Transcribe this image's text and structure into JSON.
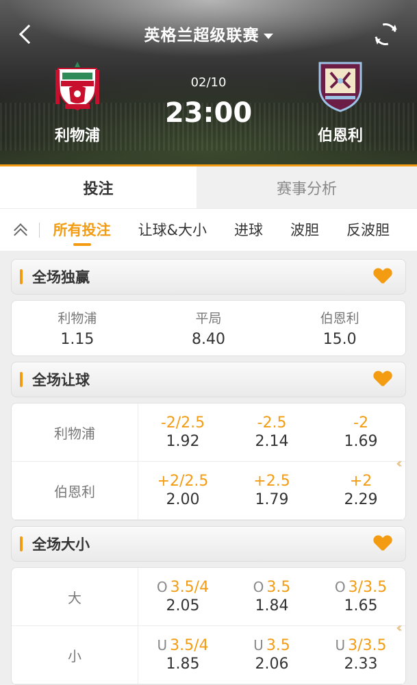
{
  "header": {
    "league": "英格兰超级联赛",
    "date": "02/10",
    "time": "23:00",
    "home_team": "利物浦",
    "away_team": "伯恩利"
  },
  "tabs": {
    "bet": "投注",
    "analysis": "赛事分析"
  },
  "sub_tabs": [
    "所有投注",
    "让球&大小",
    "进球",
    "波胆",
    "反波胆"
  ],
  "win_draw_win": {
    "title": "全场独赢",
    "items": [
      {
        "label": "利物浦",
        "odds": "1.15"
      },
      {
        "label": "平局",
        "odds": "8.40"
      },
      {
        "label": "伯恩利",
        "odds": "15.0"
      }
    ]
  },
  "handicap": {
    "title": "全场让球",
    "rows": [
      {
        "label": "利物浦",
        "cells": [
          {
            "line": "-2/2.5",
            "price": "1.92"
          },
          {
            "line": "-2.5",
            "price": "2.14"
          },
          {
            "line": "-2",
            "price": "1.69"
          }
        ]
      },
      {
        "label": "伯恩利",
        "cells": [
          {
            "line": "+2/2.5",
            "price": "2.00"
          },
          {
            "line": "+2.5",
            "price": "1.79"
          },
          {
            "line": "+2",
            "price": "2.29"
          }
        ]
      }
    ]
  },
  "over_under": {
    "title": "全场大小",
    "rows": [
      {
        "label": "大",
        "prefix": "O",
        "cells": [
          {
            "line": "3.5/4",
            "price": "2.05"
          },
          {
            "line": "3.5",
            "price": "1.84"
          },
          {
            "line": "3/3.5",
            "price": "1.65"
          }
        ]
      },
      {
        "label": "小",
        "prefix": "U",
        "cells": [
          {
            "line": "3.5/4",
            "price": "1.85"
          },
          {
            "line": "3.5",
            "price": "2.06"
          },
          {
            "line": "3/3.5",
            "price": "2.33"
          }
        ]
      }
    ]
  },
  "icons": {
    "back": "chevron-left-icon",
    "refresh": "refresh-icon",
    "favorite": "heart-icon",
    "collapse": "double-chevron-up-icon",
    "more": "double-chevron-left-icon"
  },
  "colors": {
    "accent": "#f39c12",
    "liverpool_red": "#c8102e",
    "burnley_claret": "#6c1d45"
  }
}
